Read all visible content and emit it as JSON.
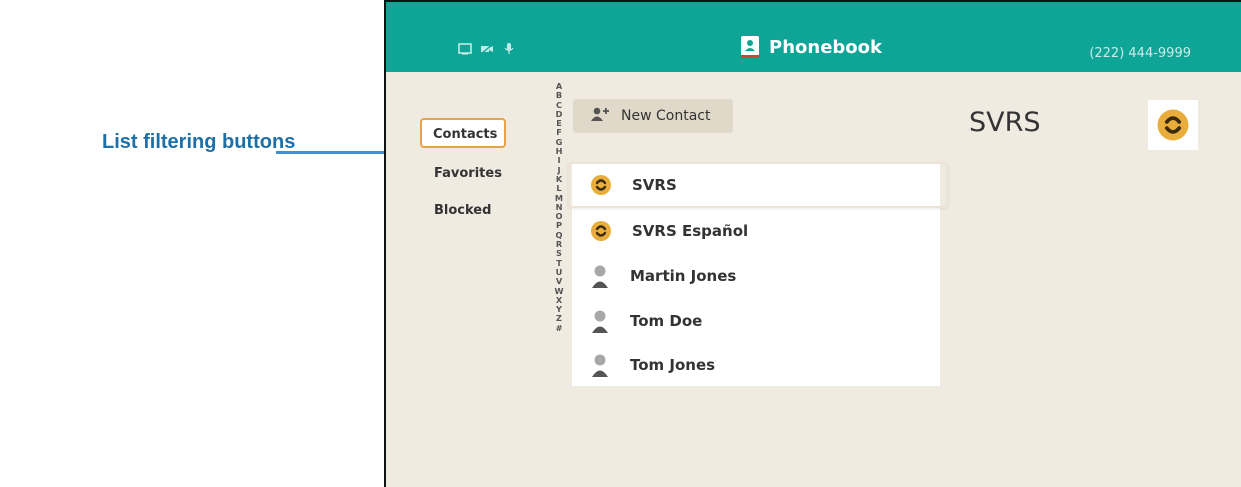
{
  "callout": {
    "label": "List filtering buttons"
  },
  "header": {
    "title": "Phonebook",
    "phone_number": "(222) 444-9999"
  },
  "filters": [
    {
      "label": "Contacts",
      "active": true
    },
    {
      "label": "Favorites",
      "active": false
    },
    {
      "label": "Blocked",
      "active": false
    }
  ],
  "alphabet": [
    "A",
    "B",
    "C",
    "D",
    "E",
    "F",
    "G",
    "H",
    "I",
    "J",
    "K",
    "L",
    "M",
    "N",
    "O",
    "P",
    "Q",
    "R",
    "S",
    "T",
    "U",
    "V",
    "W",
    "X",
    "Y",
    "Z",
    "#"
  ],
  "toolbar": {
    "new_contact_label": "New Contact"
  },
  "contacts": [
    {
      "name": "SVRS",
      "icon": "svrs-logo",
      "selected": true
    },
    {
      "name": "SVRS Español",
      "icon": "svrs-logo",
      "selected": false
    },
    {
      "name": "Martin Jones",
      "icon": "person-icon",
      "selected": false
    },
    {
      "name": "Tom Doe",
      "icon": "person-icon",
      "selected": false
    },
    {
      "name": "Tom Jones",
      "icon": "person-icon",
      "selected": false
    }
  ],
  "detail": {
    "title": "SVRS"
  },
  "colors": {
    "accent": "#0ea597",
    "highlight": "#e6a34b",
    "callout": "#3f8fd3",
    "background": "#f0ebe1"
  }
}
